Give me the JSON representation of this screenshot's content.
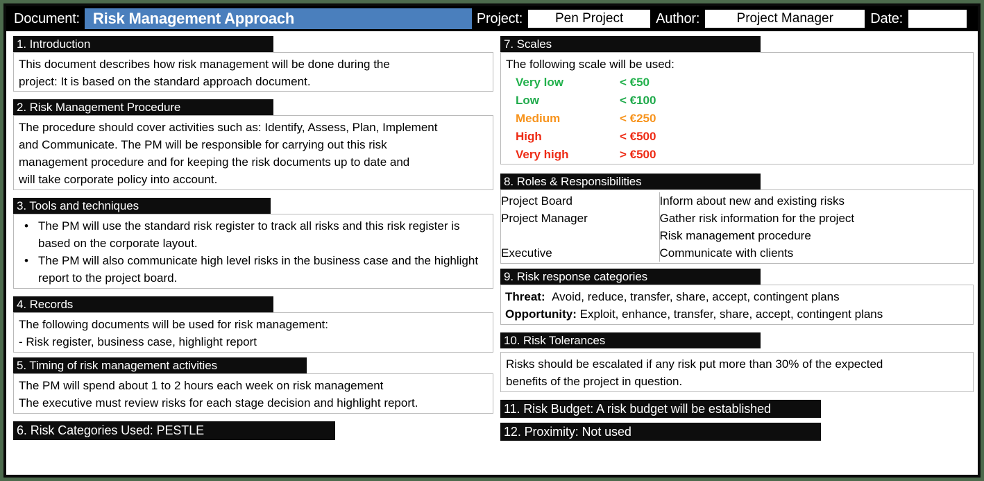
{
  "header": {
    "document_label": "Document:",
    "document_title": "Risk Management Approach",
    "project_label": "Project:",
    "project_value": "Pen Project",
    "author_label": "Author:",
    "author_value": "Project Manager",
    "date_label": "Date:",
    "date_value": ""
  },
  "colors": {
    "frame_green": "#4d6b4d",
    "title_blue": "#4a7fbd",
    "header_black": "#0d0d0d",
    "very_low": "#22b14c",
    "low": "#1faa4b",
    "medium": "#f7941e",
    "high": "#ee2b15",
    "very_high": "#ee2b15"
  },
  "left_column": {
    "s1": {
      "heading": "1. Introduction",
      "line1": "This document describes how risk management will be done during the",
      "line2": "project: It is based on the standard approach document."
    },
    "s2": {
      "heading": "2. Risk Management Procedure",
      "line1": "The procedure should cover activities such as: Identify, Assess, Plan, Implement",
      "line2": "and Communicate. The PM will be responsible for carrying out this risk",
      "line3": "management procedure and for keeping the risk documents up to date and",
      "line4": "will take corporate policy into account."
    },
    "s3": {
      "heading": "3. Tools and techniques",
      "bullets": [
        "The PM will use the standard risk register to track all risks and this risk register is based on the corporate layout.",
        "The PM will also communicate high level risks in the business case and the highlight report to the project board."
      ]
    },
    "s4": {
      "heading": "4. Records",
      "line1": "The following documents will be used for risk management:",
      "line2": "- Risk register, business case, highlight report"
    },
    "s5": {
      "heading": "5. Timing of risk management activities",
      "line1": "The PM will spend about 1 to 2 hours each week on risk management",
      "line2": "The executive must review risks for each stage decision and highlight report."
    },
    "s6": {
      "heading": "6. Risk Categories Used:  PESTLE"
    }
  },
  "right_column": {
    "s7": {
      "heading": "7. Scales",
      "intro": "The following scale will be used:",
      "rows": [
        {
          "level": "Very low",
          "value": "< €50",
          "color": "#22b14c"
        },
        {
          "level": "Low",
          "value": "< €100",
          "color": "#1faa4b"
        },
        {
          "level": "Medium",
          "value": "< €250",
          "color": "#f7941e"
        },
        {
          "level": "High",
          "value": "< €500",
          "color": "#ee2b15"
        },
        {
          "level": "Very high",
          "value": "> €500",
          "color": "#ee2b15"
        }
      ]
    },
    "s8": {
      "heading": "8. Roles & Responsibilities",
      "roles": [
        "Project Board",
        "Project Manager",
        "Executive"
      ],
      "responsibilities": [
        "Inform about new and existing risks",
        "Gather risk information for the project",
        "Risk management procedure",
        "Communicate with clients"
      ]
    },
    "s9": {
      "heading": "9. Risk response categories",
      "threat_label": "Threat:",
      "threat_value": "Avoid, reduce, transfer, share, accept, contingent plans",
      "opportunity_label": "Opportunity:",
      "opportunity_value": "Exploit, enhance, transfer, share, accept, contingent plans"
    },
    "s10": {
      "heading": "10. Risk Tolerances",
      "line1": "Risks should be escalated if any risk put more than 30% of the expected",
      "line2": "benefits of the project in question."
    },
    "s11": {
      "heading": "11. Risk Budget: A risk budget will be established"
    },
    "s12": {
      "heading": "12. Proximity: Not used"
    }
  }
}
